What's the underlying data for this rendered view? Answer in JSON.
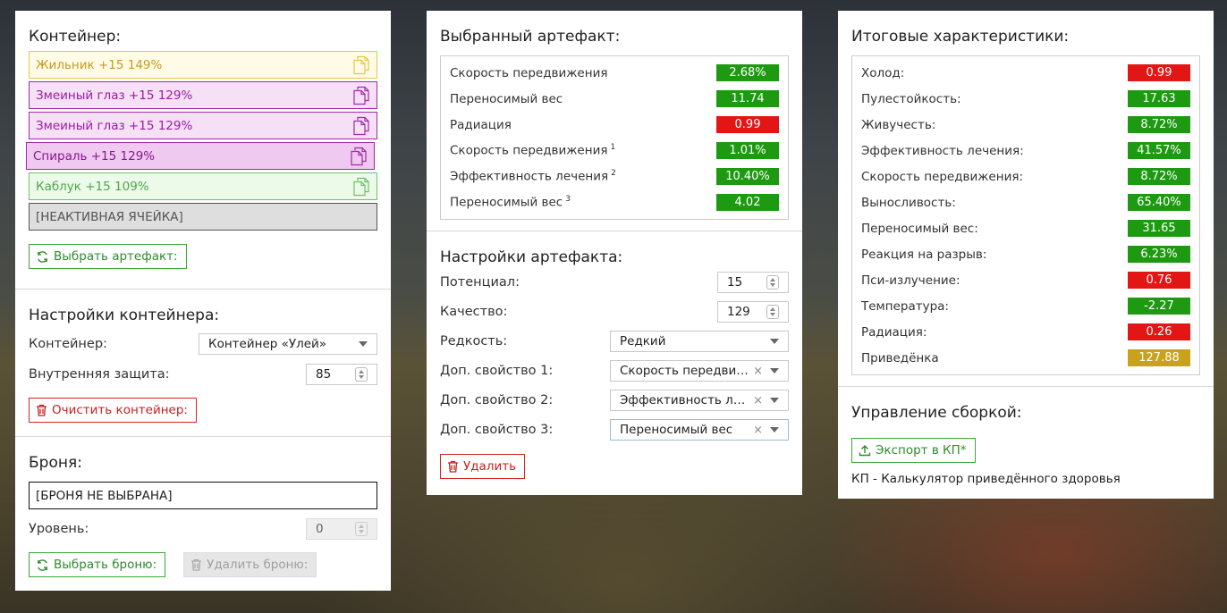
{
  "container_panel": {
    "title": "Контейнер:",
    "slots": [
      {
        "label": "Жильник +15 149%",
        "style": "yellow",
        "color": "#e8c64a"
      },
      {
        "label": "Змеиный глаз +15 129%",
        "style": "purple",
        "color": "#a12aa8"
      },
      {
        "label": "Змеиный глаз +15 129%",
        "style": "purple",
        "color": "#a12aa8"
      },
      {
        "label": "Спираль +15 129%",
        "style": "purple2",
        "color": "#a12aa8"
      },
      {
        "label": "Каблук +15 109%",
        "style": "green",
        "color": "#6fc06a"
      },
      {
        "label": "[НЕАКТИВНАЯ ЯЧЕЙКА]",
        "style": "gray",
        "color": "#555555"
      }
    ],
    "select_artifact_button": "Выбрать артефакт:"
  },
  "container_settings": {
    "title": "Настройки контейнера:",
    "container_label": "Контейнер:",
    "container_value": "Контейнер «Улей»",
    "inner_protection_label": "Внутренняя защита:",
    "inner_protection_value": "85",
    "clear_button": "Очистить контейнер:"
  },
  "armor": {
    "title": "Броня:",
    "armor_value": "[БРОНЯ НЕ ВЫБРАНА]",
    "level_label": "Уровень:",
    "level_value": "0",
    "select_button": "Выбрать броню:",
    "remove_button": "Удалить броню:"
  },
  "selected_artifact": {
    "title": "Выбранный артефакт:",
    "stats": [
      {
        "name": "Скорость передвижения",
        "sup": "",
        "value": "2.68%",
        "color": "g"
      },
      {
        "name": "Переносимый вес",
        "sup": "",
        "value": "11.74",
        "color": "g"
      },
      {
        "name": "Радиация",
        "sup": "",
        "value": "0.99",
        "color": "r"
      },
      {
        "name": "Скорость передвижения",
        "sup": "1",
        "value": "1.01%",
        "color": "g"
      },
      {
        "name": "Эффективность лечения",
        "sup": "2",
        "value": "10.40%",
        "color": "g"
      },
      {
        "name": "Переносимый вес",
        "sup": "3",
        "value": "4.02",
        "color": "g"
      }
    ]
  },
  "artifact_settings": {
    "title": "Настройки артефакта:",
    "potential_label": "Потенциал:",
    "potential_value": "15",
    "quality_label": "Качество:",
    "quality_value": "129",
    "rarity_label": "Редкость:",
    "rarity_value": "Редкий",
    "prop1_label": "Доп. свойство 1:",
    "prop1_value": "Скорость передвижения",
    "prop2_label": "Доп. свойство 2:",
    "prop2_value": "Эффективность лечения",
    "prop3_label": "Доп. свойство 3:",
    "prop3_value": "Переносимый вес",
    "clear_symbol": "×",
    "delete_button": "Удалить"
  },
  "totals": {
    "title": "Итоговые характеристики:",
    "stats": [
      {
        "name": "Холод:",
        "value": "0.99",
        "color": "r"
      },
      {
        "name": "Пулестойкость:",
        "value": "17.63",
        "color": "g"
      },
      {
        "name": "Живучесть:",
        "value": "8.72%",
        "color": "g"
      },
      {
        "name": "Эффективность лечения:",
        "value": "41.57%",
        "color": "g"
      },
      {
        "name": "Скорость передвижения:",
        "value": "8.72%",
        "color": "g"
      },
      {
        "name": "Выносливость:",
        "value": "65.40%",
        "color": "g"
      },
      {
        "name": "Переносимый вес:",
        "value": "31.65",
        "color": "g"
      },
      {
        "name": "Реакция на разрыв:",
        "value": "6.23%",
        "color": "g"
      },
      {
        "name": "Пси-излучение:",
        "value": "0.76",
        "color": "r"
      },
      {
        "name": "Температура:",
        "value": "-2.27",
        "color": "g"
      },
      {
        "name": "Радиация:",
        "value": "0.26",
        "color": "r"
      },
      {
        "name": "Приведёнка",
        "value": "127.88",
        "color": "y"
      }
    ]
  },
  "build_management": {
    "title": "Управление сборкой:",
    "export_button": "Экспорт в КП*",
    "note": "КП - Калькулятор приведённого здоровья"
  },
  "colors": {
    "green": "#1e9a12",
    "red": "#e31616",
    "yellow": "#c9a21b"
  }
}
